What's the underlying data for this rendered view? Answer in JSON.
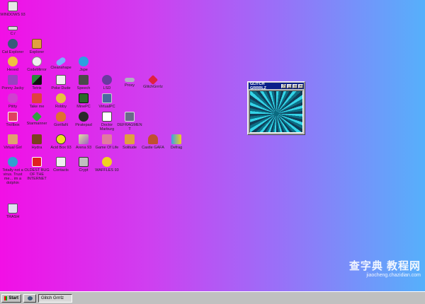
{
  "desktop": {
    "icons": [
      {
        "label": "WINDOWS 93",
        "icon": "computer-icon",
        "color": "#e6e6e6"
      },
      {
        "label": "C:/",
        "icon": "drive-icon",
        "color": "#dcdcdc"
      },
      {
        "label": "Cat Explorer",
        "icon": "cat-icon",
        "color": "#3a5a7a"
      },
      {
        "label": "Explorer",
        "icon": "folder-icon",
        "color": "#e0a040"
      },
      {
        "label": "Hexed",
        "icon": "palette-icon",
        "color": "#f0c040"
      },
      {
        "label": "CodeMirror",
        "icon": "brush-icon",
        "color": "#f0f0f0"
      },
      {
        "label": "Cleanshape",
        "icon": "capsule-icon",
        "color": "#7ab0ff"
      },
      {
        "label": "Jspe",
        "icon": "s-logo-icon",
        "color": "#2ba0e0"
      },
      {
        "label": "Ponny Jacky",
        "icon": "figure-icon",
        "color": "#9a40c0"
      },
      {
        "label": "Tetris",
        "icon": "tetris-icon",
        "color": "#2a8a3a"
      },
      {
        "label": "Poke Dude",
        "icon": "face-icon",
        "color": "#f0f0f0"
      },
      {
        "label": "Speech",
        "icon": "speaker-icon",
        "color": "#4a4a4a"
      },
      {
        "label": "LSD",
        "icon": "grapes-icon",
        "color": "#6a3aa0"
      },
      {
        "label": "Proxy",
        "icon": "glasses-icon",
        "color": "#b0b0c0"
      },
      {
        "label": "GlitchGrrrlz",
        "icon": "gem-icon",
        "color": "#e02040"
      },
      {
        "label": "Ptitty",
        "icon": "pony-icon",
        "color": "#d040d0"
      },
      {
        "label": "Take me",
        "icon": "red-box-icon",
        "color": "#e04040"
      },
      {
        "label": "Robby",
        "icon": "robot-icon",
        "color": "#e8c040"
      },
      {
        "label": "MinePC",
        "icon": "terminal-icon",
        "color": "#2a6a2a"
      },
      {
        "label": "VirtualPC",
        "icon": "monitor-icon",
        "color": "#4a6aa0"
      },
      {
        "label": "Trollbox",
        "icon": "heart-doc-icon",
        "color": "#e04060"
      },
      {
        "label": "Starmanner",
        "icon": "star-icon",
        "color": "#30a040"
      },
      {
        "label": "GorillaN",
        "icon": "fox-icon",
        "color": "#e07030"
      },
      {
        "label": "Piratepad",
        "icon": "pirate-icon",
        "color": "#2a2a2a"
      },
      {
        "label": "Doctor Marburg",
        "icon": "hat-icon",
        "color": "#ffffff"
      },
      {
        "label": "DEFRAGMENT",
        "icon": "disk-icon",
        "color": "#6a6a8a"
      },
      {
        "label": "Virtual Girl",
        "icon": "girl-icon",
        "color": "#e0a070"
      },
      {
        "label": "Hydra",
        "icon": "hydra-icon",
        "color": "#7a4020"
      },
      {
        "label": "Acid Box 93",
        "icon": "smiley-icon",
        "color": "#f0e020"
      },
      {
        "label": "Arena 93",
        "icon": "cube-icon",
        "color": "#e0e0a0"
      },
      {
        "label": "Game Of Life",
        "icon": "sprite-icon",
        "color": "#e07aa0"
      },
      {
        "label": "Solitude",
        "icon": "horse-icon",
        "color": "#e0a040"
      },
      {
        "label": "Castle GAFA",
        "icon": "person-icon",
        "color": "#c05030"
      },
      {
        "label": "Defrag",
        "icon": "pen-icon",
        "color": "#40a0e0"
      },
      {
        "label": "Totally not a virus. Trust me... im a dolphin",
        "icon": "dolphin-icon",
        "color": "#30a0d0"
      },
      {
        "label": "OLDEST BUG OF THE INTERNET",
        "icon": "red-doc-icon",
        "color": "#e02020"
      },
      {
        "label": "Contacts",
        "icon": "contacts-icon",
        "color": "#f0f0f0"
      },
      {
        "label": "Crypt",
        "icon": "lock-icon",
        "color": "#c0c0c0"
      },
      {
        "label": "WAFFLES 93",
        "icon": "question-icon",
        "color": "#f0d020"
      },
      {
        "label": "TRASH",
        "icon": "trash-icon",
        "color": "#e0e0f0"
      }
    ]
  },
  "window": {
    "title": "GLITCH GRRRLZ",
    "btn_help": "?",
    "btn_min": "_",
    "btn_max": "□",
    "btn_close": "×"
  },
  "taskbar": {
    "start_label": "Start",
    "quick_launch": "cat-icon",
    "task_label": "Glitch Grrrlz"
  },
  "watermark": {
    "main": "查字典 教程网",
    "sub": "jiaocheng.chazidian.com"
  }
}
